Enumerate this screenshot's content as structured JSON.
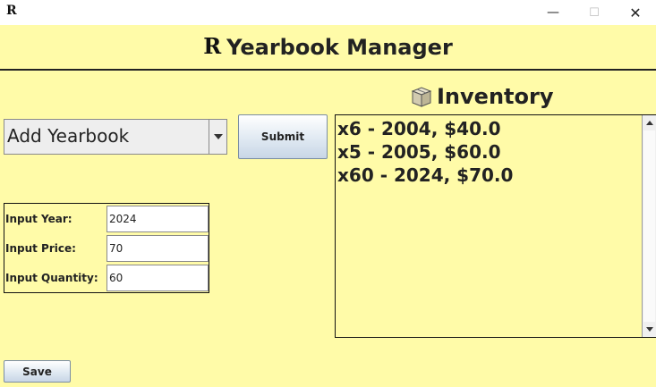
{
  "window": {
    "icon": "app-logo-icon",
    "controls": {
      "minimize": "minimize-icon",
      "maximize": "maximize-icon",
      "close": "close-icon"
    }
  },
  "header": {
    "logo_glyph": "R",
    "title": "Yearbook Manager"
  },
  "form": {
    "action_select": {
      "value": "Add Yearbook"
    },
    "submit_label": "Submit",
    "fields": [
      {
        "label": "Input Year:",
        "value": "2024"
      },
      {
        "label": "Input Price:",
        "value": "70"
      },
      {
        "label": "Input Quantity:",
        "value": "60"
      }
    ],
    "save_label": "Save"
  },
  "inventory": {
    "icon": "box-icon",
    "title": "Inventory",
    "items": [
      "x6 - 2004, $40.0",
      "x5 - 2005, $60.0",
      "x60 - 2024, $70.0"
    ]
  },
  "colors": {
    "background": "#fffba8",
    "window_chrome": "#ffffff",
    "text": "#222222"
  }
}
